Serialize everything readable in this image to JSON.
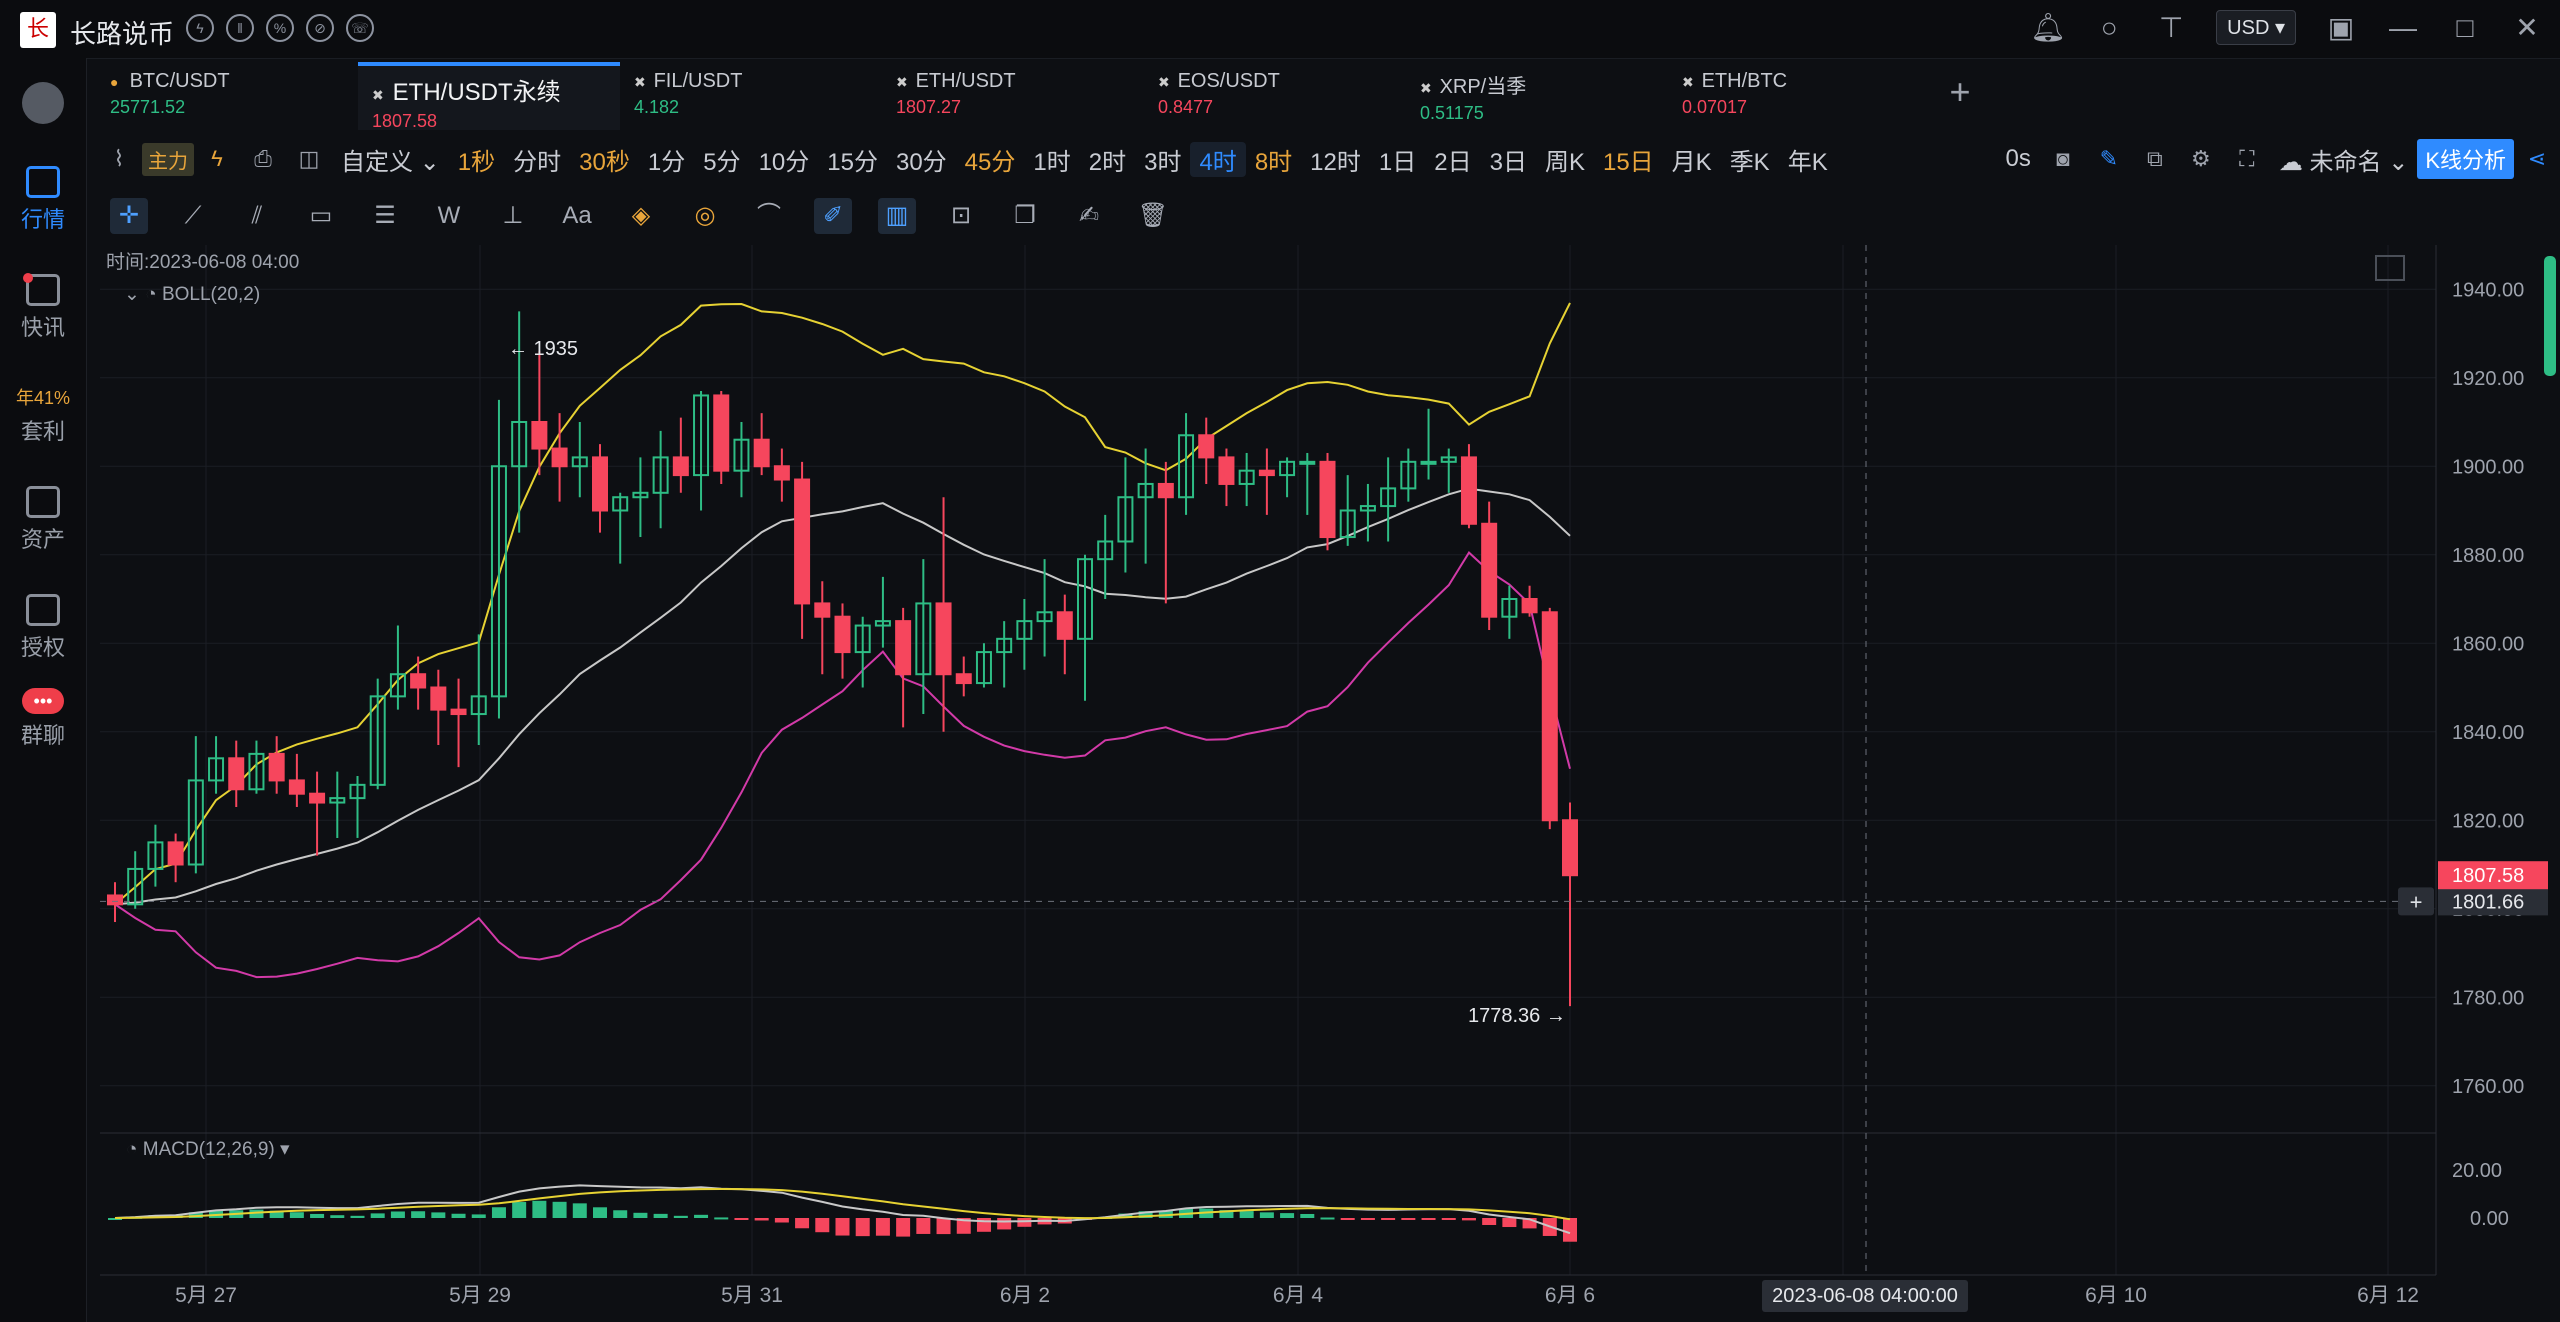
{
  "app": {
    "title": "长路说币",
    "logo_text": "长路",
    "currency": "USD"
  },
  "sidebar": {
    "items": [
      {
        "label": "行情",
        "active": true
      },
      {
        "label": "快讯",
        "active": false
      },
      {
        "label": "套利",
        "active": false,
        "extra": "年41%"
      },
      {
        "label": "资产",
        "active": false
      },
      {
        "label": "授权",
        "active": false
      },
      {
        "label": "群聊",
        "active": false,
        "badge": "•••"
      }
    ]
  },
  "tabs": [
    {
      "name": "BTC/USDT",
      "price": "25771.52",
      "price_color": "#2ebd85"
    },
    {
      "name": "ETH/USDT永续",
      "price": "1807.58",
      "price_color": "#f6465d",
      "active": true
    },
    {
      "name": "FIL/USDT",
      "price": "4.182",
      "price_color": "#2ebd85"
    },
    {
      "name": "ETH/USDT",
      "price": "1807.27",
      "price_color": "#f6465d"
    },
    {
      "name": "EOS/USDT",
      "price": "0.8477",
      "price_color": "#f6465d"
    },
    {
      "name": "XRP/当季",
      "price": "0.51175",
      "price_color": "#2ebd85"
    },
    {
      "name": "ETH/BTC",
      "price": "0.07017",
      "price_color": "#f6465d"
    }
  ],
  "toolbar": {
    "main_tag": "主力",
    "custom": "自定义",
    "intervals": [
      {
        "label": "1秒",
        "hl": true
      },
      {
        "label": "分时"
      },
      {
        "label": "30秒",
        "hl": true
      },
      {
        "label": "1分"
      },
      {
        "label": "5分"
      },
      {
        "label": "10分"
      },
      {
        "label": "15分"
      },
      {
        "label": "30分"
      },
      {
        "label": "45分",
        "hl": true
      },
      {
        "label": "1时"
      },
      {
        "label": "2时"
      },
      {
        "label": "3时"
      },
      {
        "label": "4时",
        "active": true
      },
      {
        "label": "8时",
        "hl": true
      },
      {
        "label": "12时"
      },
      {
        "label": "1日"
      },
      {
        "label": "2日"
      },
      {
        "label": "3日"
      },
      {
        "label": "周K"
      },
      {
        "label": "15日",
        "hl": true
      },
      {
        "label": "月K"
      },
      {
        "label": "季K"
      },
      {
        "label": "年K"
      }
    ],
    "countdown": "0s",
    "layout_name": "未命名",
    "kline_button": "K线分析",
    "text_tool": "Aa"
  },
  "chart_data": {
    "type": "candlestick",
    "symbol": "ETH/USDT永续",
    "time_label": "时间:2023-06-08 04:00",
    "indicator_main": "BOLL(20,2)",
    "indicator_sub": "MACD(12,26,9)",
    "ylim": [
      1750,
      1950
    ],
    "y_ticks": [
      "1940.00",
      "1920.00",
      "1900.00",
      "1880.00",
      "1860.00",
      "1840.00",
      "1820.00",
      "1800.00",
      "1780.00",
      "1760.00"
    ],
    "macd_ticks": [
      "20.00",
      "0.00"
    ],
    "x_ticks": [
      "5月 27",
      "5月 29",
      "5月 31",
      "6月 2",
      "6月 4",
      "6月 6",
      "6月 8",
      "6月 10",
      "6月 12"
    ],
    "last_price": "1807.58",
    "crosshair_price": "1801.66",
    "crosshair_time": "2023-06-08 04:00:00",
    "high_label": "1935",
    "low_label": "1778.36",
    "candles": [
      [
        1803,
        1806,
        1797,
        1801
      ],
      [
        1801,
        1813,
        1800,
        1809
      ],
      [
        1809,
        1819,
        1805,
        1815
      ],
      [
        1815,
        1817,
        1806,
        1810
      ],
      [
        1810,
        1839,
        1808,
        1829
      ],
      [
        1829,
        1839,
        1826,
        1834
      ],
      [
        1834,
        1838,
        1823,
        1827
      ],
      [
        1827,
        1838,
        1826,
        1835
      ],
      [
        1835,
        1839,
        1826,
        1829
      ],
      [
        1829,
        1835,
        1823,
        1826
      ],
      [
        1826,
        1831,
        1812,
        1824
      ],
      [
        1824,
        1831,
        1816,
        1825
      ],
      [
        1825,
        1830,
        1816,
        1828
      ],
      [
        1828,
        1852,
        1827,
        1848
      ],
      [
        1848,
        1864,
        1845,
        1853
      ],
      [
        1853,
        1857,
        1845,
        1850
      ],
      [
        1850,
        1854,
        1837,
        1845
      ],
      [
        1845,
        1852,
        1832,
        1844
      ],
      [
        1844,
        1862,
        1837,
        1848
      ],
      [
        1848,
        1915,
        1843,
        1900
      ],
      [
        1900,
        1935,
        1885,
        1910
      ],
      [
        1910,
        1926,
        1898,
        1904
      ],
      [
        1904,
        1912,
        1892,
        1900
      ],
      [
        1900,
        1910,
        1893,
        1902
      ],
      [
        1902,
        1905,
        1885,
        1890
      ],
      [
        1890,
        1894,
        1878,
        1893
      ],
      [
        1893,
        1902,
        1884,
        1894
      ],
      [
        1894,
        1908,
        1886,
        1902
      ],
      [
        1902,
        1911,
        1894,
        1898
      ],
      [
        1898,
        1917,
        1890,
        1916
      ],
      [
        1916,
        1917,
        1896,
        1899
      ],
      [
        1899,
        1910,
        1893,
        1906
      ],
      [
        1906,
        1912,
        1898,
        1900
      ],
      [
        1900,
        1904,
        1892,
        1897
      ],
      [
        1897,
        1901,
        1861,
        1869
      ],
      [
        1869,
        1874,
        1853,
        1866
      ],
      [
        1866,
        1869,
        1852,
        1858
      ],
      [
        1858,
        1866,
        1850,
        1864
      ],
      [
        1864,
        1875,
        1859,
        1865
      ],
      [
        1865,
        1868,
        1841,
        1853
      ],
      [
        1853,
        1879,
        1844,
        1869
      ],
      [
        1869,
        1893,
        1840,
        1853
      ],
      [
        1853,
        1857,
        1848,
        1851
      ],
      [
        1851,
        1860,
        1850,
        1858
      ],
      [
        1858,
        1865,
        1850,
        1861
      ],
      [
        1861,
        1870,
        1854,
        1865
      ],
      [
        1865,
        1879,
        1857,
        1867
      ],
      [
        1867,
        1871,
        1853,
        1861
      ],
      [
        1861,
        1880,
        1847,
        1879
      ],
      [
        1879,
        1889,
        1870,
        1883
      ],
      [
        1883,
        1902,
        1876,
        1893
      ],
      [
        1893,
        1904,
        1878,
        1896
      ],
      [
        1896,
        1901,
        1869,
        1893
      ],
      [
        1893,
        1912,
        1889,
        1907
      ],
      [
        1907,
        1911,
        1896,
        1902
      ],
      [
        1902,
        1904,
        1891,
        1896
      ],
      [
        1896,
        1903,
        1891,
        1899
      ],
      [
        1899,
        1904,
        1889,
        1898
      ],
      [
        1898,
        1902,
        1893,
        1901
      ],
      [
        1901,
        1903,
        1889,
        1901
      ],
      [
        1901,
        1903,
        1881,
        1884
      ],
      [
        1884,
        1898,
        1882,
        1890
      ],
      [
        1890,
        1896,
        1883,
        1891
      ],
      [
        1891,
        1902,
        1883,
        1895
      ],
      [
        1895,
        1904,
        1892,
        1901
      ],
      [
        1901,
        1913,
        1897,
        1901
      ],
      [
        1901,
        1904,
        1894,
        1902
      ],
      [
        1902,
        1905,
        1886,
        1887
      ],
      [
        1887,
        1892,
        1863,
        1866
      ],
      [
        1866,
        1873,
        1861,
        1870
      ],
      [
        1870,
        1873,
        1866,
        1867
      ],
      [
        1867,
        1868,
        1818,
        1820
      ],
      [
        1820,
        1824,
        1778,
        1807.58
      ]
    ]
  }
}
